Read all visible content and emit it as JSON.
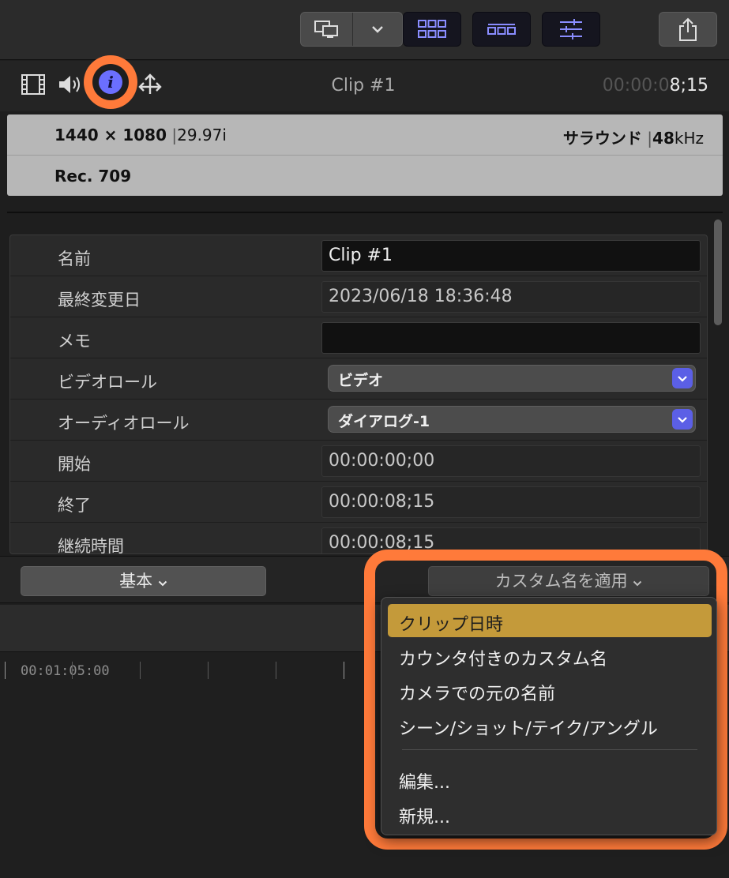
{
  "inspector": {
    "clip_title": "Clip #1",
    "timecode_dim": "00:00:0",
    "timecode_bright": "8;15"
  },
  "format": {
    "resolution": "1440 × 1080",
    "frame_rate": "29.97i",
    "audio_channels": "サラウンド",
    "sample_rate_value": "48",
    "sample_rate_unit": "kHz",
    "color_space": "Rec. 709"
  },
  "properties": {
    "name": {
      "label": "名前",
      "value": "Clip #1"
    },
    "modified": {
      "label": "最終変更日",
      "value": "2023/06/18 18:36:48"
    },
    "notes": {
      "label": "メモ",
      "value": ""
    },
    "video_role": {
      "label": "ビデオロール",
      "value": "ビデオ"
    },
    "audio_role": {
      "label": "オーディオロール",
      "value": "ダイアログ-1"
    },
    "start": {
      "label": "開始",
      "value": "00:00:00;00"
    },
    "end": {
      "label": "終了",
      "value": "00:00:08;15"
    },
    "duration": {
      "label": "継続時間",
      "value": "00:00:08;15"
    }
  },
  "bottom_bar": {
    "basic_label": "基本",
    "apply_label": "カスタム名を適用"
  },
  "timeline": {
    "ruler_timecode": "00:01:05:00"
  },
  "menu": {
    "items": [
      "クリップ日時",
      "カウンタ付きのカスタム名",
      "カメラでの元の名前",
      "シーン/ショット/テイク/アングル"
    ],
    "actions": [
      "編集...",
      "新規..."
    ]
  },
  "colors": {
    "highlight": "#ff7a3a",
    "selection": "#c49a3a",
    "accent": "#5b5fe6"
  }
}
